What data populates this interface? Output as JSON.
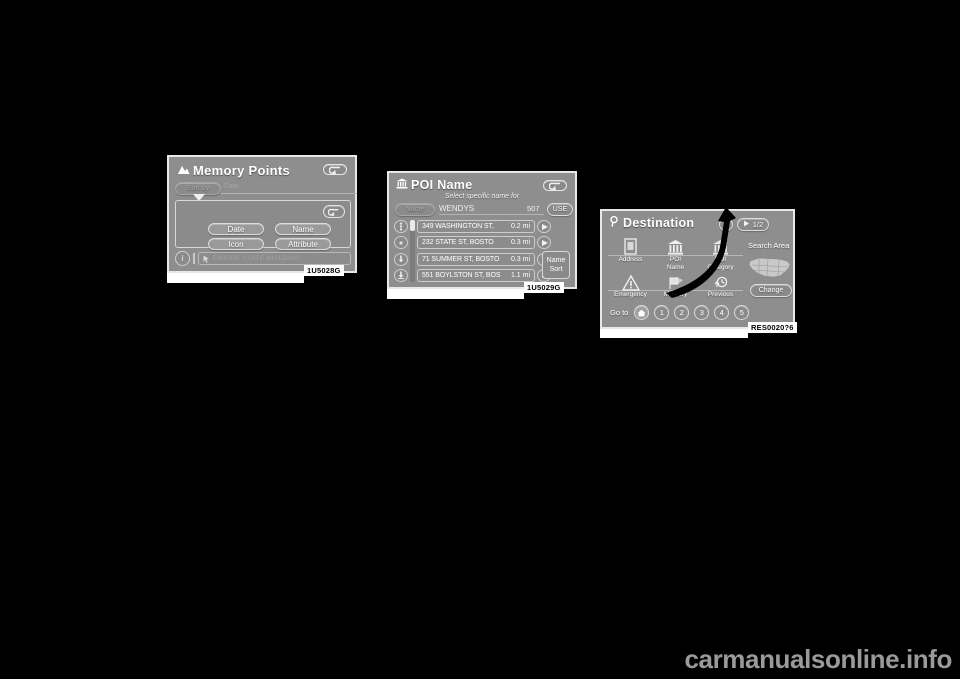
{
  "page": {
    "background_color": "#000000",
    "watermark": "carmanualsonline.info"
  },
  "screens": [
    {
      "id": "memory-points",
      "title": "Memory Points",
      "title_icon": "mountain-marker-icon",
      "back_icon": "return-arrow-icon",
      "tab": {
        "label": "Sort by",
        "value": "Date"
      },
      "panel": {
        "back_icon": "return-arrow-icon",
        "buttons": [
          "Date",
          "Name",
          "Icon",
          "Attribute"
        ]
      },
      "footer": {
        "info_icon": "info-icon",
        "point_icon": "map-pointer-icon",
        "point_name": "EMPIRE STATE BUILDING"
      },
      "caption": "1U5028G"
    },
    {
      "id": "poi-name",
      "title": "POI Name",
      "title_icon": "bank-building-icon",
      "back_icon": "return-arrow-icon",
      "subtitle": "Select specific name for",
      "search_tab": "Name",
      "query": "WENDYS",
      "result_count": "507",
      "use_button": "USE",
      "scroll_buttons": [
        "scroll-page-up-icon",
        "scroll-up-icon",
        "scroll-down-icon",
        "scroll-bottom-icon"
      ],
      "list": [
        {
          "address": "349 WASHINGTON ST,",
          "distance": "0.2 mi"
        },
        {
          "address": "232 STATE ST, BOSTO",
          "distance": "0.3 mi"
        },
        {
          "address": "71 SUMMER ST, BOSTO",
          "distance": "0.3 mi"
        },
        {
          "address": "551 BOYLSTON ST, BOS",
          "distance": "1.1 mi"
        }
      ],
      "row_arrow_icon": "play-arrow-icon",
      "sort_button": {
        "line1": "Name",
        "line2": "Sort"
      },
      "caption": "1U5029G"
    },
    {
      "id": "destination",
      "title": "Destination",
      "title_icon": "magnifier-pin-icon",
      "help_button": "?",
      "page_button": "1/2",
      "page_button_icon": "next-arrow-icon",
      "cells": [
        {
          "label": "Address",
          "icon": "address-card-icon"
        },
        {
          "label": "POI\nName",
          "icon": "bank-building-icon"
        },
        {
          "label": "POI\nCategory",
          "icon": "bank-building-icon"
        },
        {
          "label": "Emergency",
          "icon": "warning-triangle-icon"
        },
        {
          "label": "Memory",
          "icon": "memory-flag-icon"
        },
        {
          "label": "Previous",
          "icon": "previous-clock-icon"
        }
      ],
      "search_area_label": "Search Area",
      "map_icon": "usa-map-icon",
      "change_button": "Change",
      "goto_label": "Go to",
      "goto_home_icon": "home-icon",
      "goto_numbers": [
        "1",
        "2",
        "3",
        "4",
        "5"
      ],
      "caption": "RES0020?6"
    }
  ],
  "annotation": {
    "type": "curved-arrow",
    "points_to": "help_button"
  }
}
